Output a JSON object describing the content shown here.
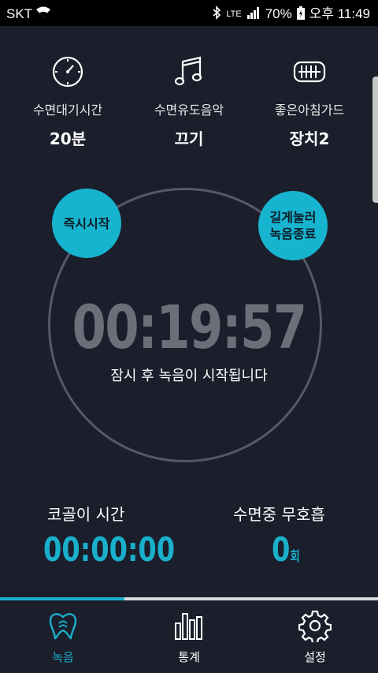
{
  "status_bar": {
    "carrier": "SKT",
    "network": "LTE",
    "battery": "70%",
    "time": "오후 11:49"
  },
  "top_settings": [
    {
      "icon": "clock-icon",
      "label": "수면대기시간",
      "value": "20분"
    },
    {
      "icon": "music-note-icon",
      "label": "수면유도음악",
      "value": "끄기"
    },
    {
      "icon": "mouthguard-icon",
      "label": "좋은아침가드",
      "value": "장치2"
    }
  ],
  "timer": {
    "time": "00:19:57",
    "message": "잠시 후 녹음이 시작됩니다",
    "start_now": "즉시시작",
    "long_press_stop": "길게눌러\n녹음종료"
  },
  "stats": {
    "snoring_label": "코골이 시간",
    "snoring_value": "00:00:00",
    "apnea_label": "수면중 무호흡",
    "apnea_value": "0",
    "apnea_unit": "회"
  },
  "progress": {
    "value": 0.33
  },
  "nav": [
    {
      "icon": "tooth-icon",
      "label": "녹음",
      "active": true
    },
    {
      "icon": "bar-chart-icon",
      "label": "통계",
      "active": false
    },
    {
      "icon": "gear-icon",
      "label": "설정",
      "active": false
    }
  ],
  "colors": {
    "background": "#1b1e2b",
    "accent": "#1ab0cc",
    "timer_text": "#6b6f7a"
  }
}
